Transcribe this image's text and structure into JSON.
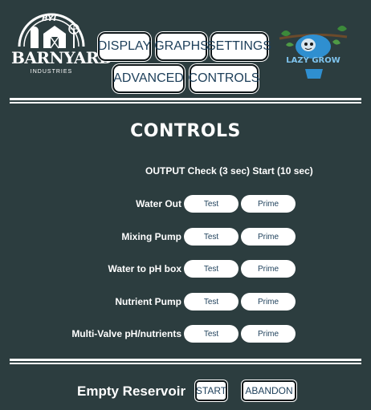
{
  "logos": {
    "left": {
      "badge": "BYI",
      "name": "BARNYARD",
      "sub": "INDUSTRIES"
    },
    "right": {
      "name": "LAZY GROW"
    }
  },
  "nav": {
    "display": "DISPLAY",
    "graphs": "GRAPHS",
    "settings": "SETTINGS",
    "advanced": "ADVANCED",
    "controls": "CONTROLS"
  },
  "page": {
    "title": "CONTROLS"
  },
  "table": {
    "header": "OUTPUT Check (3 sec) Start (10 sec)",
    "rows": [
      {
        "label": "Water Out",
        "check": "Test",
        "start": "Prime"
      },
      {
        "label": "Mixing Pump",
        "check": "Test",
        "start": "Prime"
      },
      {
        "label": "Water to pH box",
        "check": "Test",
        "start": "Prime"
      },
      {
        "label": "Nutrient Pump",
        "check": "Test",
        "start": "Prime"
      },
      {
        "label": "Multi-Valve pH/nutrients",
        "check": "Test",
        "start": "Prime"
      }
    ]
  },
  "footer": {
    "label": "Empty Reservoir",
    "start": "START",
    "abandon": "ABANDON"
  },
  "colors": {
    "background": "#2c3d3f",
    "button_text": "#1d3f5a",
    "sloth_blue": "#2f8fd0"
  }
}
